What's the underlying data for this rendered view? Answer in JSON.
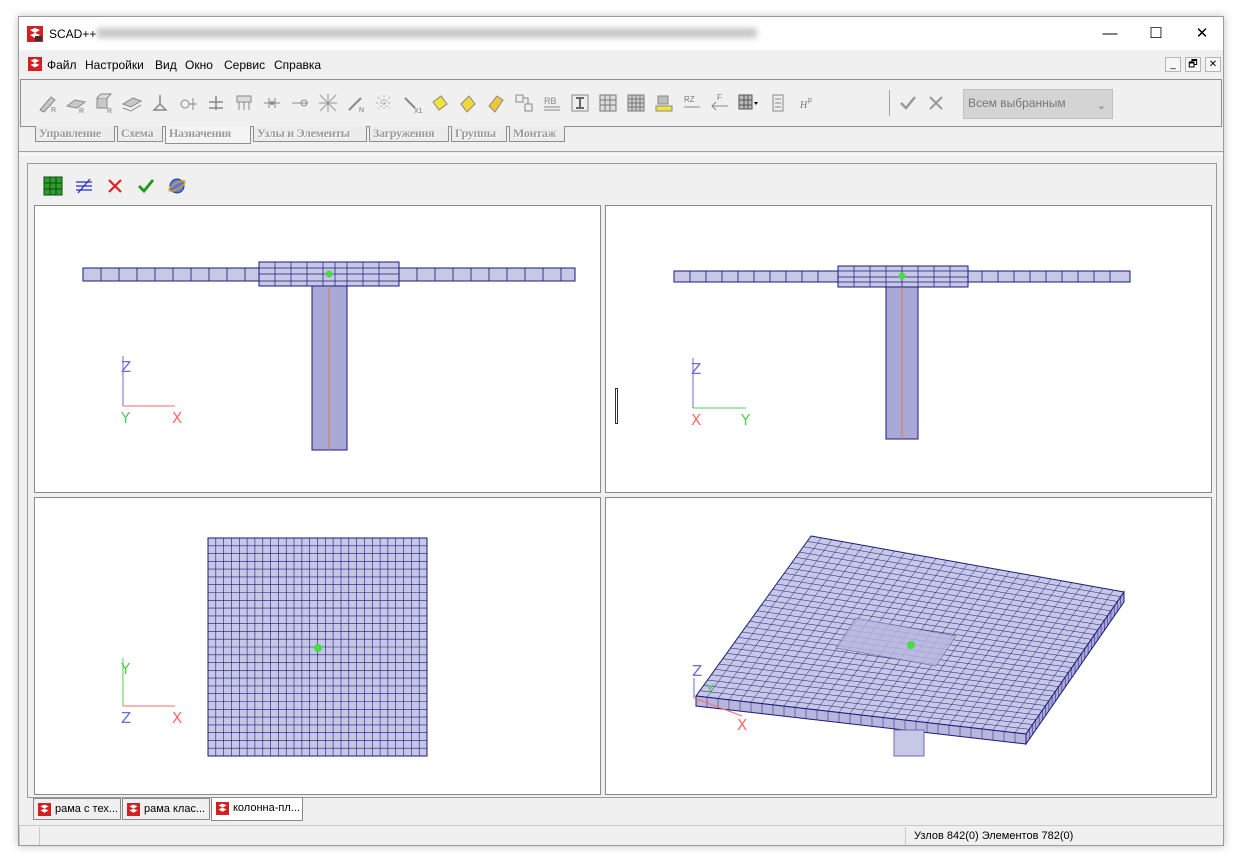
{
  "window": {
    "title": "SCAD++",
    "controls": {
      "minimize": "—",
      "maximize": "☐",
      "close": "✕"
    }
  },
  "menu": {
    "items": [
      "Файл",
      "Настройки",
      "Вид",
      "Окно",
      "Сервис",
      "Справка"
    ],
    "mdi_controls": [
      "_",
      "🗗",
      "✕"
    ]
  },
  "toolbar": {
    "combo_value": "Всем выбранным"
  },
  "ribbon_tabs": [
    {
      "label": "Управление",
      "active": false
    },
    {
      "label": "Схема",
      "active": false
    },
    {
      "label": "Назначения",
      "active": true
    },
    {
      "label": "Узлы и Элементы",
      "active": false
    },
    {
      "label": "Загружения",
      "active": false
    },
    {
      "label": "Группы",
      "active": false
    },
    {
      "label": "Монтаж",
      "active": false
    }
  ],
  "viewports": {
    "front": {
      "axes": [
        "Z",
        "Y",
        "X"
      ]
    },
    "side": {
      "axes": [
        "Z",
        "X",
        "Y"
      ]
    },
    "top": {
      "axes": [
        "Y",
        "Z",
        "X"
      ]
    },
    "iso": {
      "axes": [
        "Z",
        "Y",
        "X"
      ]
    }
  },
  "colors": {
    "axis_x": "#ff6a6a",
    "axis_y": "#55cc55",
    "axis_z": "#6b6bd6",
    "mesh_fill": "#c7c7e6",
    "mesh_line": "#1a1a7a",
    "node_highlight": "#44dd44"
  },
  "document_tabs": [
    {
      "label": "рама с тех...",
      "active": false
    },
    {
      "label": "рама клас...",
      "active": false
    },
    {
      "label": "колонна-пл...",
      "active": true
    }
  ],
  "status": {
    "text": "Узлов 842(0) Элементов 782(0)"
  }
}
